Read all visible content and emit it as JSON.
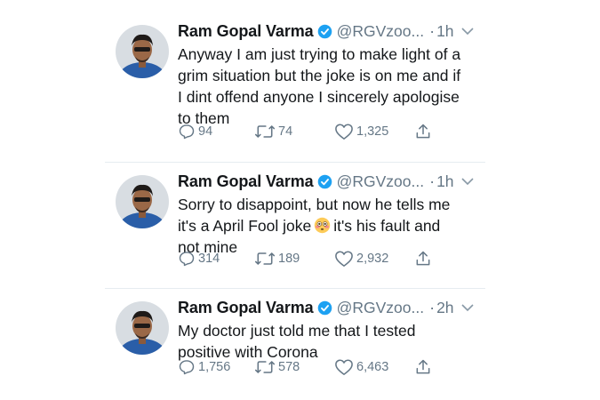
{
  "tweets": [
    {
      "name": "Ram Gopal Varma",
      "handle": "@RGVzoo...",
      "time": "1h",
      "lines": [
        "Anyway I am just trying to make light of a",
        "grim situation but the joke is on me and if",
        "I dint offend anyone I sincerely apologise",
        "to them"
      ],
      "replies": "94",
      "retweets": "74",
      "likes": "1,325"
    },
    {
      "name": "Ram Gopal Varma",
      "handle": "@RGVzoo...",
      "time": "1h",
      "lines": [
        "Sorry to disappoint, but now he tells me",
        "it's a April Fool joke",
        "not mine"
      ],
      "line2_after_emoji": "it's his fault and",
      "emoji": "flushed-face-emoji",
      "replies": "314",
      "retweets": "189",
      "likes": "2,932"
    },
    {
      "name": "Ram Gopal Varma",
      "handle": "@RGVzoo...",
      "time": "2h",
      "lines": [
        "My doctor just told me that I tested",
        "positive with Corona"
      ],
      "replies": "1,756",
      "retweets": "578",
      "likes": "6,463"
    }
  ],
  "colors": {
    "text": "#14171a",
    "secondary": "#657786",
    "verified": "#1da1f2",
    "divider": "#e6ecf0"
  },
  "icons": [
    "verified-badge-icon",
    "caret-down-icon",
    "reply-icon",
    "retweet-icon",
    "like-icon",
    "share-icon"
  ]
}
